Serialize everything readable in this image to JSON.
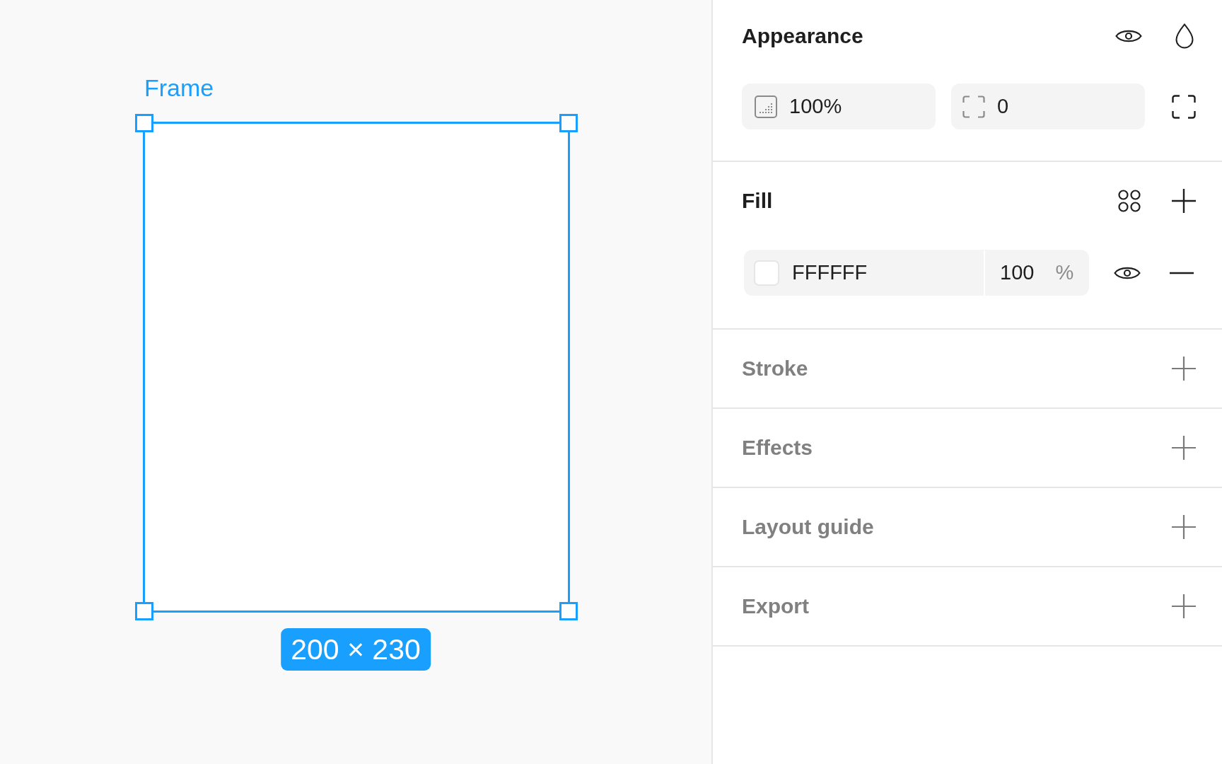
{
  "canvas": {
    "frame": {
      "label": "Frame",
      "size": "200 × 230",
      "selected": true
    }
  },
  "panel": {
    "sections": [
      {
        "kind": "appearance",
        "title": "Appearance",
        "opacity": "100%",
        "corner_radius": "0"
      },
      {
        "kind": "fill",
        "title": "Fill",
        "fills": [
          {
            "color": "#ffffff",
            "hex": "FFFFFF",
            "opacity": "100",
            "unit": "%"
          }
        ]
      },
      {
        "kind": "empty",
        "title": "Stroke"
      },
      {
        "kind": "empty",
        "title": "Effects"
      },
      {
        "kind": "empty",
        "title": "Layout guide"
      },
      {
        "kind": "empty",
        "title": "Export"
      }
    ]
  }
}
